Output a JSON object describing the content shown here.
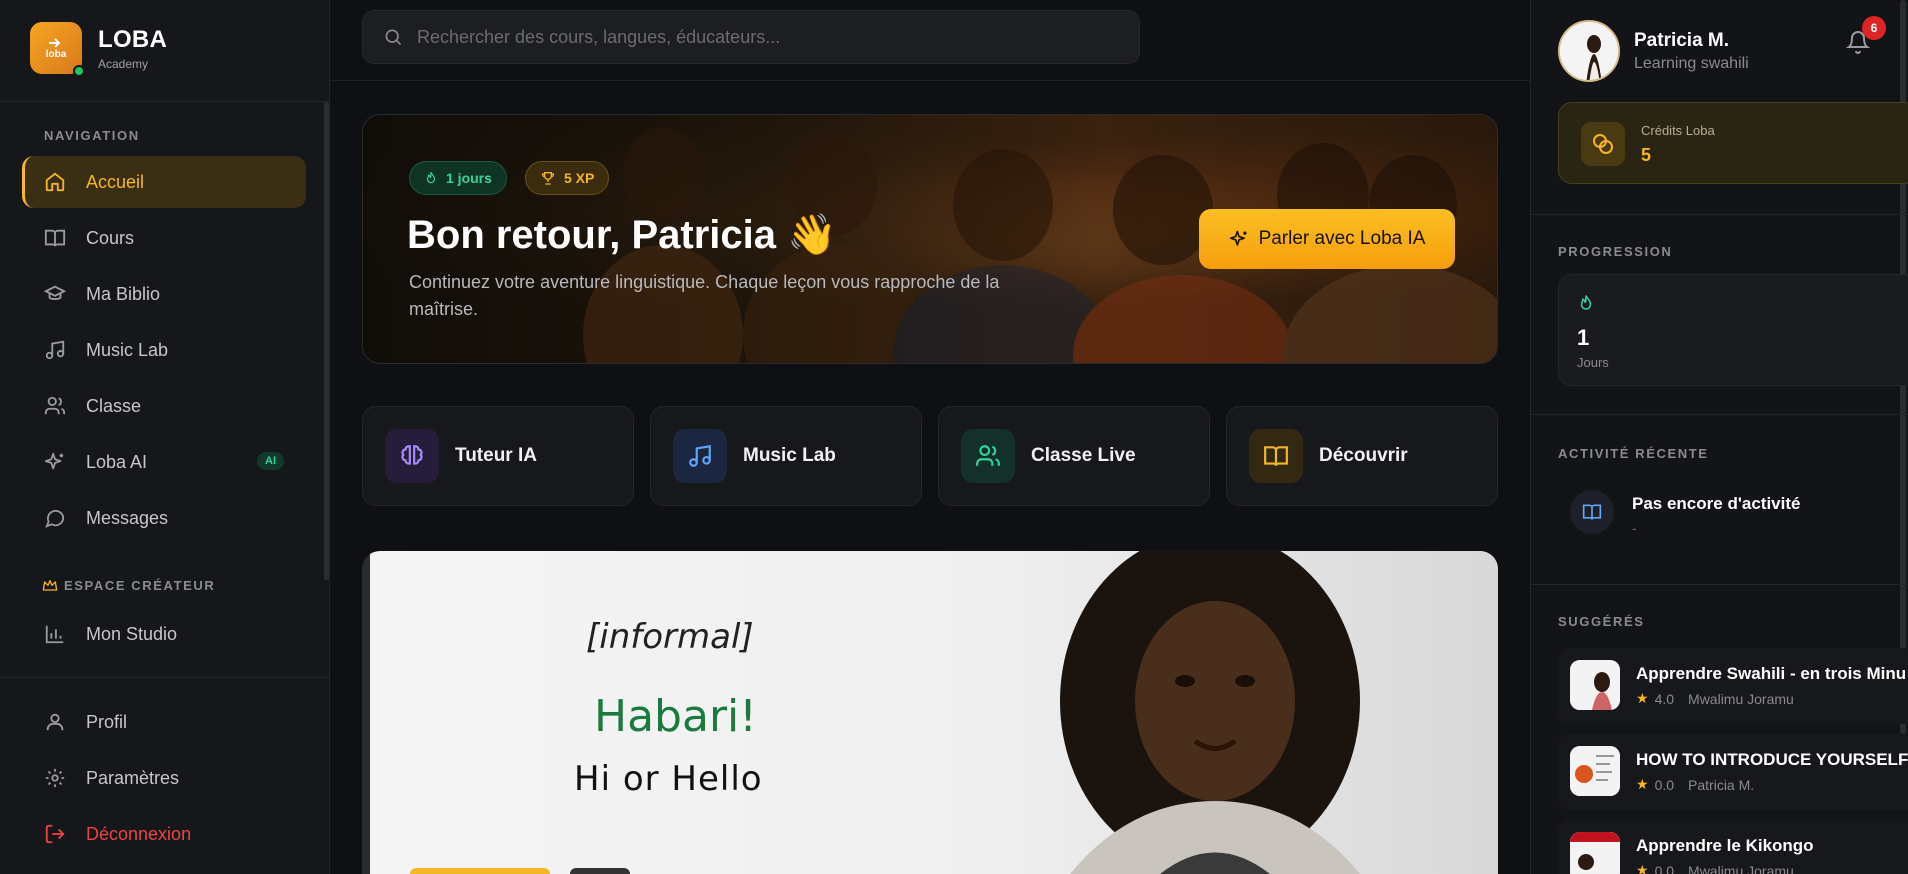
{
  "brand": {
    "name": "LOBA",
    "sub": "Academy",
    "logo_text": "loba"
  },
  "nav": {
    "section_label": "NAVIGATION",
    "items": [
      {
        "label": "Accueil",
        "icon": "home-icon"
      },
      {
        "label": "Cours",
        "icon": "book-icon"
      },
      {
        "label": "Ma Biblio",
        "icon": "graduation-cap-icon"
      },
      {
        "label": "Music Lab",
        "icon": "music-icon"
      },
      {
        "label": "Classe",
        "icon": "users-icon"
      },
      {
        "label": "Loba AI",
        "icon": "sparkles-icon",
        "badge": "AI"
      },
      {
        "label": "Messages",
        "icon": "message-icon"
      }
    ],
    "creator_label": "ESPACE CRÉATEUR",
    "creator_items": [
      {
        "label": "Mon Studio",
        "icon": "chart-icon"
      }
    ],
    "bottom_items": [
      {
        "label": "Profil",
        "icon": "user-icon"
      },
      {
        "label": "Paramètres",
        "icon": "gear-icon"
      },
      {
        "label": "Déconnexion",
        "icon": "logout-icon"
      }
    ]
  },
  "search": {
    "placeholder": "Rechercher des cours, langues, éducateurs..."
  },
  "hero": {
    "streak_chip": "1 jours",
    "xp_chip": "5 XP",
    "title": "Bon retour, Patricia 👋",
    "subtitle": "Continuez votre aventure linguistique. Chaque leçon vous rapproche de la maîtrise.",
    "cta": "Parler avec Loba IA"
  },
  "quick_cards": [
    {
      "label": "Tuteur IA",
      "icon": "brain-icon"
    },
    {
      "label": "Music Lab",
      "icon": "music-icon"
    },
    {
      "label": "Classe Live",
      "icon": "users-icon"
    },
    {
      "label": "Découvrir",
      "icon": "open-book-icon"
    }
  ],
  "video": {
    "line1": "[informal]",
    "line2": "Habari!",
    "line3": "Hi or Hello"
  },
  "user": {
    "name": "Patricia M.",
    "sub": "Learning swahili",
    "notifications": "6"
  },
  "credits": {
    "label": "Crédits Loba",
    "value": "5"
  },
  "progression": {
    "label": "PROGRESSION",
    "value": "1",
    "unit": "Jours"
  },
  "activity": {
    "label": "ACTIVITÉ RÉCENTE",
    "title": "Pas encore d'activité",
    "sub": "-"
  },
  "suggested": {
    "label": "SUGGÉRÉS",
    "items": [
      {
        "title": "Apprendre Swahili - en trois Minu",
        "rating": "4.0",
        "author": "Mwalimu Joramu"
      },
      {
        "title": "HOW TO INTRODUCE YOURSELF IN",
        "rating": "0.0",
        "author": "Patricia M."
      },
      {
        "title": "Apprendre le Kikongo",
        "rating": "0.0",
        "author": "Mwalimu Joramu"
      }
    ]
  },
  "colors": {
    "accent": "#f5b62a",
    "bg": "#0f1013",
    "danger": "#ef4444",
    "green": "#34d399"
  }
}
